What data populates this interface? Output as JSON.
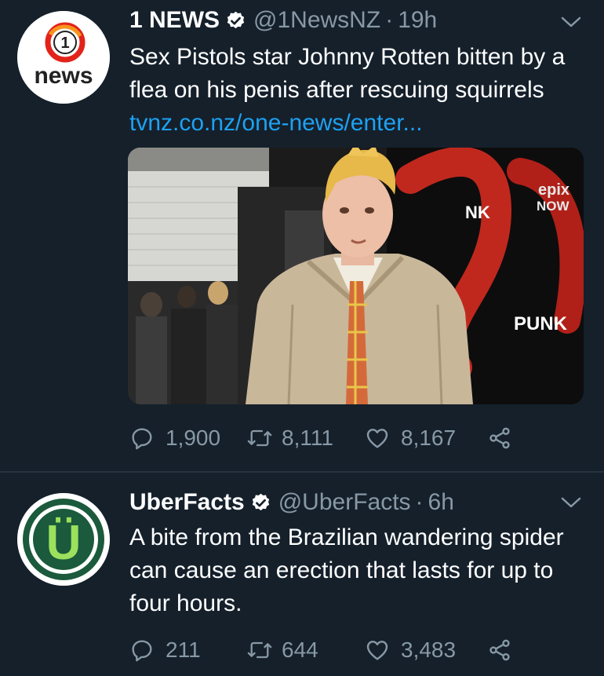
{
  "colors": {
    "background": "#15202b",
    "primary_text": "#ffffff",
    "secondary_text": "#8899a6",
    "link": "#1da1f2",
    "divider": "#253341"
  },
  "tweets": [
    {
      "display_name": "1 NEWS",
      "verified_icon": "verified-badge-icon",
      "handle": "@1NewsNZ",
      "separator": "·",
      "time": "19h",
      "text": "Sex Pistols star Johnny Rotten bitten by a flea on his penis after rescuing squirrels ",
      "link": "tvnz.co.nz/one-news/enter...",
      "avatar": {
        "icon": "1news-logo-icon",
        "logo_number": "1",
        "logo_word": "news"
      },
      "media": {
        "icon": "photo-man-blonde-hair-beige-jacket-icon",
        "backdrop_text_1": "NK",
        "backdrop_text_2": "PUNK",
        "backdrop_logo_1": "epix",
        "backdrop_logo_2": "NOW"
      },
      "replies": "1,900",
      "retweets": "8,111",
      "likes": "8,167"
    },
    {
      "display_name": "UberFacts",
      "verified_icon": "verified-badge-icon",
      "handle": "@UberFacts",
      "separator": "·",
      "time": "6h",
      "text": "A bite from the Brazilian wandering spider can cause an erection that lasts for up to four hours.",
      "avatar": {
        "icon": "uberfacts-logo-icon",
        "logo_letter": "Ü"
      },
      "replies": "211",
      "retweets": "644",
      "likes": "3,483"
    }
  ]
}
